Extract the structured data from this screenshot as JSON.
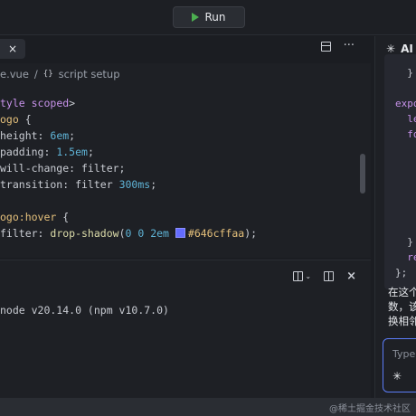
{
  "toolbar": {
    "run_label": "Run"
  },
  "editor": {
    "tab_close": "×",
    "more": "···",
    "breadcrumb": {
      "file": "e.vue",
      "sep": "/",
      "icon": "{}",
      "section": "script setup"
    },
    "code": [
      [
        {
          "c": "kw",
          "t": "tyle "
        },
        {
          "c": "kw",
          "t": "scoped"
        },
        {
          "c": "",
          "t": ">"
        }
      ],
      [
        {
          "c": "sel",
          "t": "ogo"
        },
        {
          "c": "",
          "t": " {"
        }
      ],
      [
        {
          "c": "",
          "t": "height: "
        },
        {
          "c": "num",
          "t": "6em"
        },
        {
          "c": "",
          "t": ";"
        }
      ],
      [
        {
          "c": "",
          "t": "padding: "
        },
        {
          "c": "num",
          "t": "1.5em"
        },
        {
          "c": "",
          "t": ";"
        }
      ],
      [
        {
          "c": "",
          "t": "will-change: filter;"
        }
      ],
      [
        {
          "c": "",
          "t": "transition: filter "
        },
        {
          "c": "num",
          "t": "300ms"
        },
        {
          "c": "",
          "t": ";"
        }
      ],
      [
        {
          "c": "",
          "t": ""
        }
      ],
      [
        {
          "c": "sel",
          "t": "ogo:hover"
        },
        {
          "c": "",
          "t": " {"
        }
      ],
      [
        {
          "c": "",
          "t": "filter: "
        },
        {
          "c": "fn",
          "t": "drop-shadow"
        },
        {
          "c": "",
          "t": "("
        },
        {
          "c": "num",
          "t": "0 0 2em "
        },
        {
          "c": "swatch",
          "t": ""
        },
        {
          "c": "hex",
          "t": "#646cffaa"
        },
        {
          "c": "",
          "t": ");"
        }
      ]
    ]
  },
  "terminal": {
    "close": "×",
    "output": "node v20.14.0 (npm v10.7.0)"
  },
  "ai": {
    "title": "AI",
    "code": [
      [
        {
          "c": "",
          "t": "  }"
        }
      ],
      [
        {
          "c": "",
          "t": ""
        }
      ],
      [
        {
          "c": "kw",
          "t": "expo"
        }
      ],
      [
        {
          "c": "kw",
          "t": "  le"
        }
      ],
      [
        {
          "c": "kw",
          "t": "  fo"
        }
      ],
      [
        {
          "c": "",
          "t": ""
        }
      ],
      [
        {
          "c": "",
          "t": ""
        }
      ],
      [
        {
          "c": "",
          "t": ""
        }
      ],
      [
        {
          "c": "",
          "t": ""
        }
      ],
      [
        {
          "c": "",
          "t": ""
        }
      ],
      [
        {
          "c": "",
          "t": ""
        }
      ],
      [
        {
          "c": "",
          "t": "  }"
        }
      ],
      [
        {
          "c": "kw",
          "t": "  re"
        }
      ],
      [
        {
          "c": "",
          "t": "};"
        }
      ]
    ],
    "text": "在这个\n数，该\n换相邻",
    "input_placeholder": "Type a"
  },
  "watermark": "@稀土掘金技术社区",
  "colors": {
    "accent": "#5b7cf7",
    "run": "#4caf50",
    "swatch": "#646cff"
  }
}
